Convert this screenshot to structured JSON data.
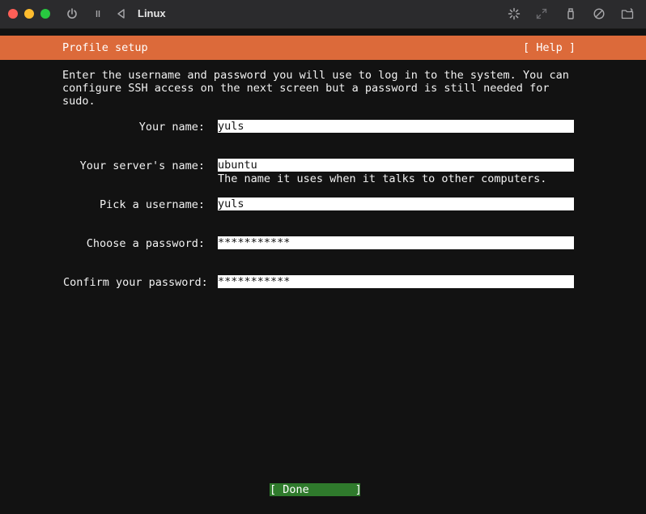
{
  "window": {
    "title": "Linux",
    "icons": [
      "power-icon",
      "pause-icon",
      "back-icon",
      "spinner-icon",
      "resize-icon",
      "usb-icon",
      "disc-icon",
      "folder-share-icon"
    ]
  },
  "header": {
    "title": "Profile setup",
    "help_label": "[ Help ]"
  },
  "intro_text": "Enter the username and password you will use to log in to the system. You can configure SSH access on the next screen but a password is still needed for sudo.",
  "form": {
    "your_name": {
      "label": "Your name:",
      "value": "yuls"
    },
    "server_name": {
      "label": "Your server's name:",
      "value": "ubuntu",
      "hint": "The name it uses when it talks to other computers."
    },
    "username": {
      "label": "Pick a username:",
      "value": "yuls"
    },
    "password": {
      "label": "Choose a password:",
      "value": "***********"
    },
    "confirm_password": {
      "label": "Confirm your password:",
      "value": "***********"
    }
  },
  "footer": {
    "done_label": "[ Done       ]"
  },
  "colors": {
    "header": "#dc6a3a",
    "done": "#2f7a2c",
    "background": "#121212"
  }
}
